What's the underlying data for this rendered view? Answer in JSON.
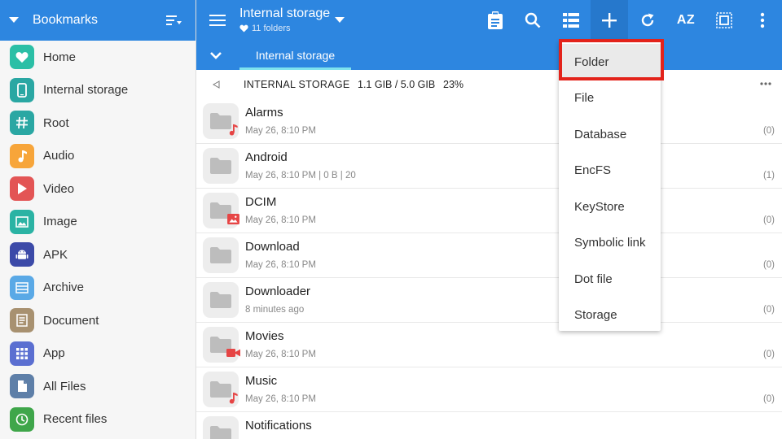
{
  "sidebar": {
    "title": "Bookmarks",
    "items": [
      {
        "label": "Home",
        "icon": "heart-icon",
        "color": "#2bbfa6"
      },
      {
        "label": "Internal storage",
        "icon": "phone-icon",
        "color": "#2aa7a3"
      },
      {
        "label": "Root",
        "icon": "hash-icon",
        "color": "#2aa7a3"
      },
      {
        "label": "Audio",
        "icon": "music-note-icon",
        "color": "#f7a53a"
      },
      {
        "label": "Video",
        "icon": "play-icon",
        "color": "#e35555"
      },
      {
        "label": "Image",
        "icon": "image-icon",
        "color": "#2bb3a4"
      },
      {
        "label": "APK",
        "icon": "android-icon",
        "color": "#3c4aa8"
      },
      {
        "label": "Archive",
        "icon": "archive-icon",
        "color": "#5aa9e6"
      },
      {
        "label": "Document",
        "icon": "document-icon",
        "color": "#a89170"
      },
      {
        "label": "App",
        "icon": "app-grid-icon",
        "color": "#5b6fd1"
      },
      {
        "label": "All Files",
        "icon": "file-icon",
        "color": "#5e7fa8"
      },
      {
        "label": "Recent files",
        "icon": "clock-icon",
        "color": "#3fa64a"
      }
    ]
  },
  "toolbar": {
    "title": "Internal storage",
    "subtitle": "11 folders",
    "sort_label": "AZ"
  },
  "tab": {
    "label": "Internal storage"
  },
  "path": {
    "name": "INTERNAL STORAGE",
    "size": "1.1 GIB / 5.0 GIB",
    "percent": "23%"
  },
  "files": [
    {
      "name": "Alarms",
      "meta": "May 26, 8:10 PM",
      "count": "(0)",
      "badge": "music-note-icon"
    },
    {
      "name": "Android",
      "meta": "May 26, 8:10 PM | 0 B | 20",
      "count": "(1)",
      "badge": ""
    },
    {
      "name": "DCIM",
      "meta": "May 26, 8:10 PM",
      "count": "(0)",
      "badge": "image-icon"
    },
    {
      "name": "Download",
      "meta": "May 26, 8:10 PM",
      "count": "(0)",
      "badge": ""
    },
    {
      "name": "Downloader",
      "meta": "8 minutes ago",
      "count": "(0)",
      "badge": ""
    },
    {
      "name": "Movies",
      "meta": "May 26, 8:10 PM",
      "count": "(0)",
      "badge": "video-camera-icon"
    },
    {
      "name": "Music",
      "meta": "May 26, 8:10 PM",
      "count": "(0)",
      "badge": "music-note-icon"
    },
    {
      "name": "Notifications",
      "meta": "",
      "count": "",
      "badge": ""
    }
  ],
  "new_menu": {
    "items": [
      {
        "label": "Folder"
      },
      {
        "label": "File"
      },
      {
        "label": "Database"
      },
      {
        "label": "EncFS"
      },
      {
        "label": "KeyStore"
      },
      {
        "label": "Symbolic link"
      },
      {
        "label": "Dot file"
      },
      {
        "label": "Storage"
      }
    ],
    "selected_index": 0
  },
  "colors": {
    "primary": "#2d86e0",
    "accent_tab": "#7fe3ee",
    "highlight": "#e3231b",
    "badge_red": "#e64545"
  }
}
